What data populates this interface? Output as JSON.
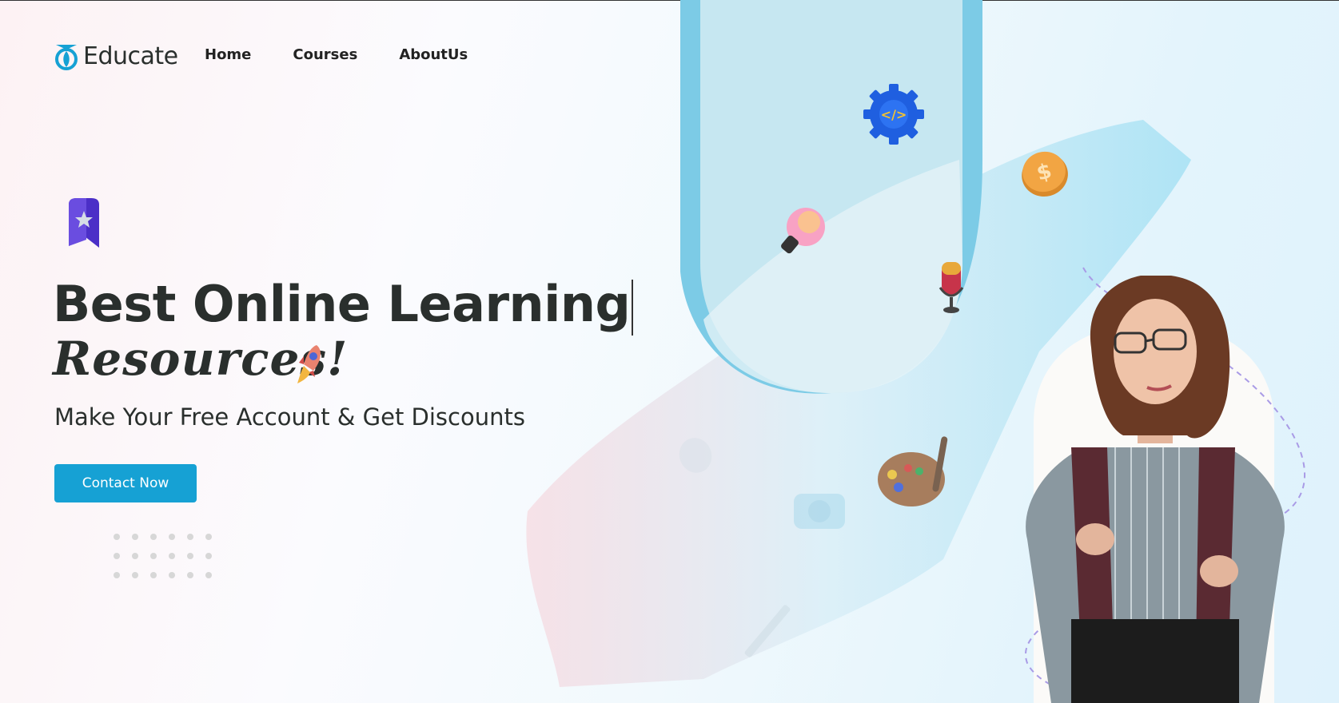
{
  "brand": {
    "name": "Educate",
    "icon": "rocket-logo-icon",
    "accent": "#16a1d4"
  },
  "nav": {
    "items": [
      "Home",
      "Courses",
      "AboutUs"
    ]
  },
  "hero": {
    "title": "Best Online Learning",
    "script": "Resources!",
    "subtitle": "Make Your Free Account & Get Discounts",
    "cta": "Contact Now"
  },
  "icons": [
    "bookmark-star-icon",
    "rocket-icon",
    "gear-code-icon",
    "coin-dollar-icon",
    "light-bulb-icon",
    "microphone-icon",
    "paint-palette-icon",
    "camera-icon",
    "pencil-icon"
  ],
  "colors": {
    "text": "#2a2f2d",
    "button": "#16a1d4",
    "panel": "#7ccbe6"
  }
}
